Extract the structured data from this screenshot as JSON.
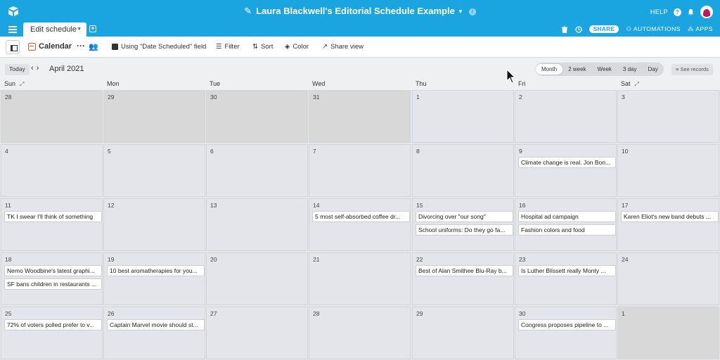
{
  "header": {
    "title": "Laura Blackwell's Editorial Schedule Example",
    "help": "HELP"
  },
  "tabbar": {
    "active_tab": "Edit schedule",
    "share": "SHARE",
    "automations": "AUTOMATIONS",
    "apps": "APPS"
  },
  "toolbar": {
    "view_name": "Calendar",
    "field_label": "Using \"Date Scheduled\" field",
    "filter": "Filter",
    "sort": "Sort",
    "color": "Color",
    "share_view": "Share view"
  },
  "calendar": {
    "today": "Today",
    "month": "April 2021",
    "ranges": [
      "Month",
      "2 week",
      "Week",
      "3 day",
      "Day"
    ],
    "active_range": "Month",
    "see_records": "See records",
    "weekdays": [
      "Sun",
      "Mon",
      "Tue",
      "Wed",
      "Thu",
      "Fri",
      "Sat"
    ],
    "weeks": [
      [
        {
          "n": "28",
          "muted": true
        },
        {
          "n": "29",
          "muted": true
        },
        {
          "n": "30",
          "muted": true
        },
        {
          "n": "31",
          "muted": true
        },
        {
          "n": "1"
        },
        {
          "n": "2"
        },
        {
          "n": "3"
        }
      ],
      [
        {
          "n": "4"
        },
        {
          "n": "5"
        },
        {
          "n": "6"
        },
        {
          "n": "7"
        },
        {
          "n": "8"
        },
        {
          "n": "9",
          "events": [
            "Climate change is real. Jon Bon..."
          ]
        },
        {
          "n": "10"
        }
      ],
      [
        {
          "n": "11",
          "events": [
            "TK I swear I'll think of something"
          ]
        },
        {
          "n": "12"
        },
        {
          "n": "13"
        },
        {
          "n": "14",
          "events": [
            "5 most self-absorbed coffee dr..."
          ]
        },
        {
          "n": "15",
          "events": [
            "Divorcing over \"our song\"",
            "School uniforms: Do they go fa..."
          ]
        },
        {
          "n": "16",
          "events": [
            "Hospital ad campaign",
            "Fashion colors and food"
          ]
        },
        {
          "n": "17",
          "events": [
            "Karen Eliot's new band debuts ..."
          ]
        }
      ],
      [
        {
          "n": "18",
          "events": [
            "Nemo Woodbine's latest graphi...",
            "SF bans children in restaurants ..."
          ]
        },
        {
          "n": "19",
          "events": [
            "10 best aromatherapies for you..."
          ]
        },
        {
          "n": "20"
        },
        {
          "n": "21"
        },
        {
          "n": "22",
          "events": [
            "Best of Alan Smithee Blu-Ray b..."
          ]
        },
        {
          "n": "23",
          "events": [
            "Is Luther Blissett really Monty ..."
          ]
        },
        {
          "n": "24"
        }
      ],
      [
        {
          "n": "25",
          "events": [
            "72% of voters polled prefer to v..."
          ]
        },
        {
          "n": "26",
          "events": [
            "Captain Marvel movie should st..."
          ]
        },
        {
          "n": "27"
        },
        {
          "n": "28"
        },
        {
          "n": "29"
        },
        {
          "n": "30",
          "events": [
            "Congress proposes pipeline to ..."
          ]
        },
        {
          "n": "1",
          "muted": true
        }
      ]
    ]
  }
}
